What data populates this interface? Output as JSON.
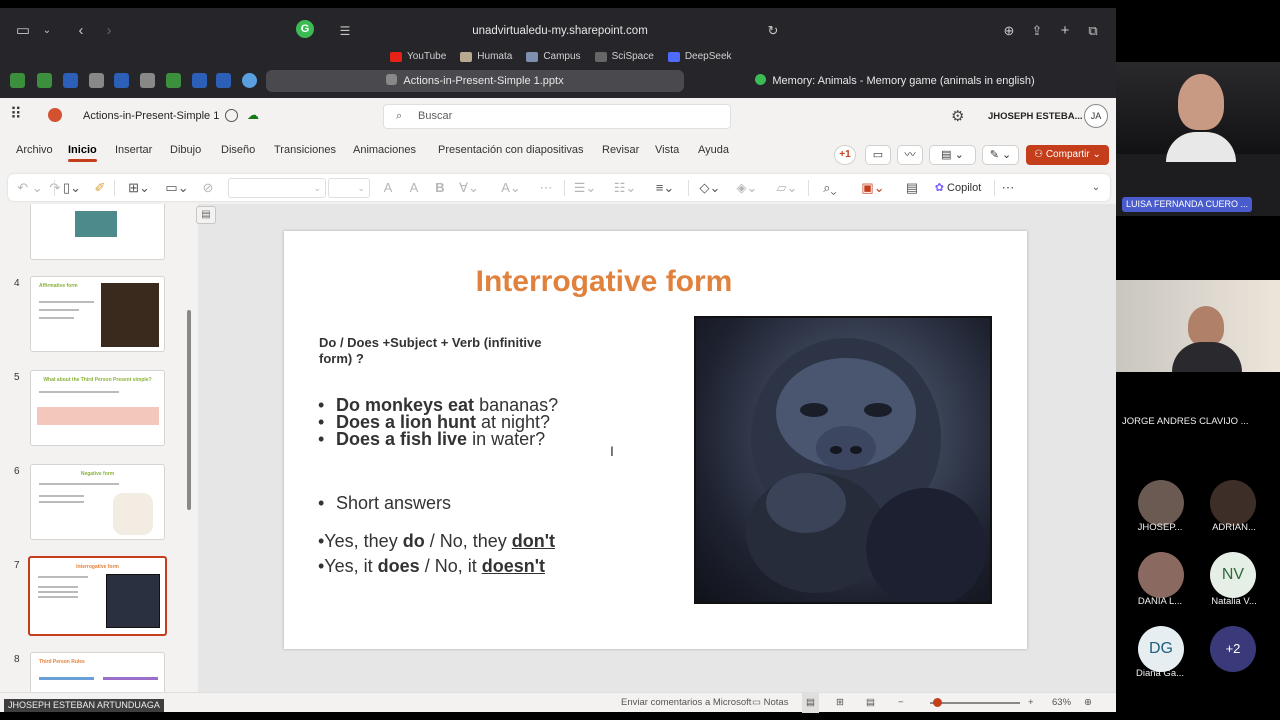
{
  "browser": {
    "url": "unadvirtualedu-my.sharepoint.com",
    "bookmarks": [
      {
        "label": "YouTube",
        "color": "#e62117"
      },
      {
        "label": "Humata",
        "color": "#b9a98e"
      },
      {
        "label": "Campus",
        "color": "#7f8fb0"
      },
      {
        "label": "SciSpace",
        "color": "#666666"
      },
      {
        "label": "DeepSeek",
        "color": "#4d6bfe"
      }
    ],
    "tabs": [
      {
        "label": "Actions-in-Present-Simple 1.pptx",
        "active": true
      },
      {
        "label": "Memory: Animals - Memory game (animals in english)",
        "active": false
      }
    ]
  },
  "app": {
    "doc_title": "Actions-in-Present-Simple 1",
    "search_placeholder": "Buscar",
    "user_name": "JHOSEPH ESTEBA...",
    "user_initials": "JA",
    "share_label": "Compartir",
    "comments_badge": "+1",
    "menu": [
      "Archivo",
      "Inicio",
      "Insertar",
      "Dibujo",
      "Diseño",
      "Transiciones",
      "Animaciones",
      "Presentación con diapositivas",
      "Revisar",
      "Vista",
      "Ayuda"
    ],
    "active_menu": "Inicio",
    "copilot_label": "Copilot"
  },
  "slide_pane": {
    "thumbs": [
      {
        "number": "",
        "title": ""
      },
      {
        "number": "4",
        "title": "Affirmative form"
      },
      {
        "number": "5",
        "title": "What about the Third Person Present simple?"
      },
      {
        "number": "6",
        "title": "Negative form"
      },
      {
        "number": "7",
        "title": "Interrogative form"
      },
      {
        "number": "8",
        "title": "Third Person Rules"
      }
    ]
  },
  "slide": {
    "title": "Interrogative form",
    "structure": "Do / Does  +Subject + Verb (infinitive form) ?",
    "questions": [
      {
        "bold": "Do monkeys eat",
        "rest": " bananas?"
      },
      {
        "bold": "Does a lion hunt",
        "rest": " at night?"
      },
      {
        "bold": "Does a fish live",
        "rest": " in water?"
      }
    ],
    "short_answers_label": "Short answers",
    "answers": [
      {
        "pre": "•Yes, they ",
        "b1": "do",
        "mid": " / No, they ",
        "b2": "don't"
      },
      {
        "pre": "•Yes, it ",
        "b1": "does",
        "mid": " / No, it ",
        "b2": "doesn't"
      }
    ]
  },
  "status": {
    "feedback": "Enviar comentarios a Microsoft",
    "notes": "Notas",
    "zoom": "63%"
  },
  "presenter_label": "JHOSEPH ESTEBAN ARTUNDUAGA",
  "participants": {
    "main1_name": "LUISA FERNANDA CUERO ...",
    "main2_name": "JORGE ANDRES CLAVIJO ...",
    "small": [
      {
        "name": "JHOSEP...",
        "initials": "",
        "photo": true
      },
      {
        "name": "ADRIAN...",
        "initials": "",
        "photo": true
      },
      {
        "name": "DANIA L...",
        "initials": "",
        "photo": true
      },
      {
        "name": "Natalia V...",
        "initials": "NV",
        "photo": false
      },
      {
        "name": "Diana Ga...",
        "initials": "DG",
        "photo": false
      },
      {
        "name": "",
        "initials": "+2",
        "photo": false
      }
    ]
  }
}
